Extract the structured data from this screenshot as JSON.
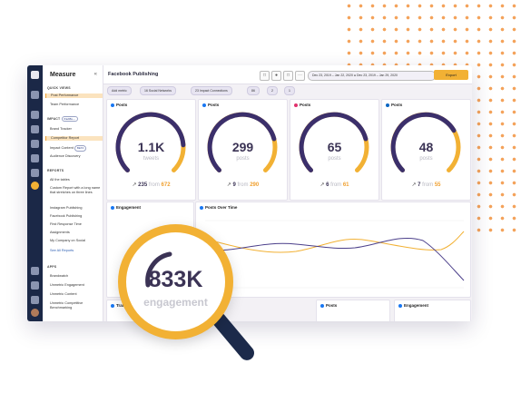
{
  "app": {
    "section_title": "Measure",
    "collapse_icon": "double-chevron-left-icon",
    "page_title": "Facebook Publishing"
  },
  "sidebar": {
    "quick_views_label": "QUICK VIEWS",
    "quick_views": [
      "Post Performance",
      "Team Performance"
    ],
    "impact_label": "IMPACT",
    "impact_pill": "Califo...",
    "impact_items": [
      "Brand Tracker",
      "Competitor Report",
      "Impact Content",
      "Audience Discovery"
    ],
    "impact_badge": "BETA",
    "reports_label": "REPORTS",
    "reports_items": [
      "All the tables",
      "Custom Report with a long name that stretches on three lines",
      "Instagram Publishing",
      "Facebook Publishing",
      "First Response Time",
      "Assignments",
      "My Company on Social"
    ],
    "see_all": "See All Reports",
    "apps_label": "APPS",
    "apps_items": [
      "Brandwatch",
      "Unmetric Engagement",
      "Unmetric Content",
      "Unmetric Competitive Benchmarking"
    ]
  },
  "toolbar": {
    "date_range": "Dec 23, 2019 – Jan 22, 2020  ●  Dec 23, 2019 – Jan 29, 2020",
    "export_label": "Export"
  },
  "filters": [
    "Add metric",
    "16 Social Networks",
    "23 Impact Connections",
    "86",
    "2",
    "1"
  ],
  "cards": [
    {
      "title": "Posts",
      "network": "facebook",
      "value": "1.1K",
      "unit": "tweets",
      "delta": "235",
      "from_word": "from",
      "from": "672",
      "fill": 0.82
    },
    {
      "title": "Posts",
      "network": "facebook",
      "value": "299",
      "unit": "posts",
      "delta": "9",
      "from_word": "from",
      "from": "290",
      "fill": 0.78
    },
    {
      "title": "Posts",
      "network": "instagram",
      "value": "65",
      "unit": "posts",
      "delta": "6",
      "from_word": "from",
      "from": "61",
      "fill": 0.78
    },
    {
      "title": "Posts",
      "network": "linkedin",
      "value": "48",
      "unit": "posts",
      "delta": "7",
      "from_word": "from",
      "from": "55",
      "fill": 0.72
    }
  ],
  "engagement_card_title": "Engagement",
  "posts_over_time_title": "Posts Over Time",
  "bottom_cards": [
    "Traffic",
    "Posts",
    "Engagement"
  ],
  "magnifier": {
    "value": "833K",
    "label": "engagement"
  },
  "colors": {
    "accent": "#f2b134",
    "brand": "#3b2f6b",
    "rail": "#1b2847"
  }
}
